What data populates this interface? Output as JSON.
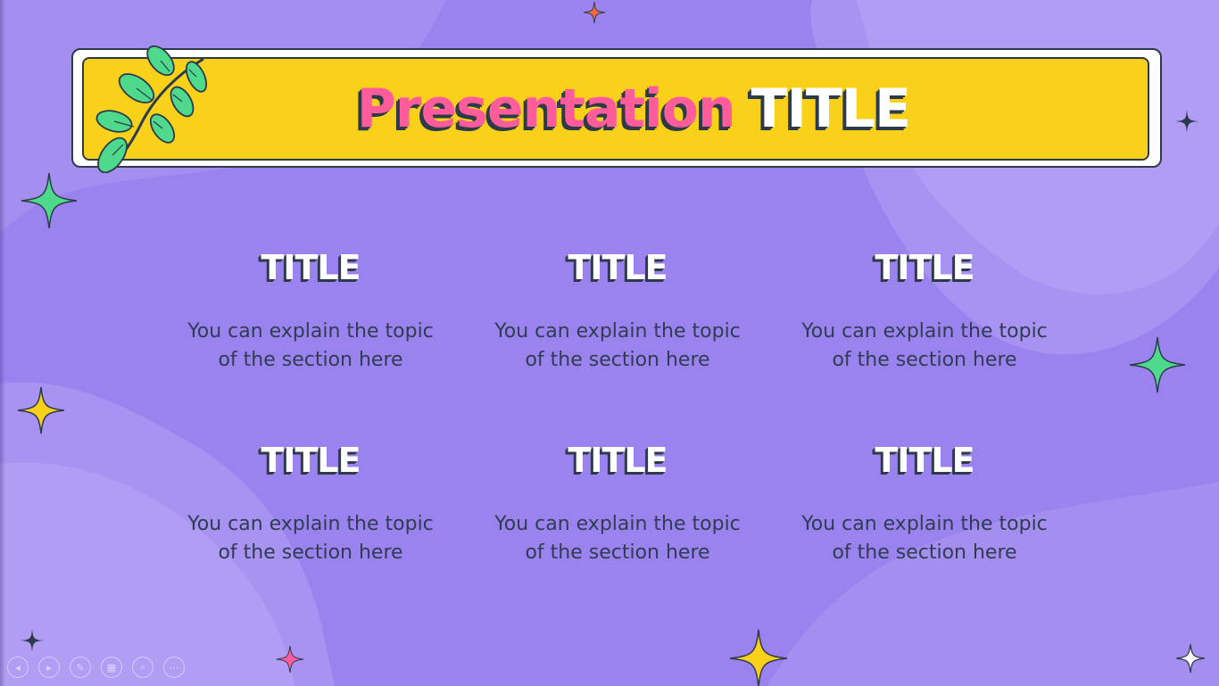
{
  "slide": {
    "title_part1": "Presentation",
    "title_part2": "TITLE",
    "sections": [
      {
        "title": "TITLE",
        "line1": "You can explain the topic",
        "line2": "of the section here"
      },
      {
        "title": "TITLE",
        "line1": "You can explain the topic",
        "line2": "of the section here"
      },
      {
        "title": "TITLE",
        "line1": "You can explain the topic",
        "line2": "of the section here"
      },
      {
        "title": "TITLE",
        "line1": "You can explain the topic",
        "line2": "of the section here"
      },
      {
        "title": "TITLE",
        "line1": "You can explain the topic",
        "line2": "of the section here"
      },
      {
        "title": "TITLE",
        "line1": "You can explain the topic",
        "line2": "of the section here"
      }
    ]
  },
  "colors": {
    "background": "#9b83ef",
    "banner_yellow": "#fad11a",
    "title_pink": "#ff5c9b",
    "outline_dark": "#2c3a4a",
    "sparkle_green": "#4ed98c",
    "sparkle_yellow": "#fad11a",
    "sparkle_pink": "#ff5c9b",
    "sparkle_orange": "#ff6b3d"
  },
  "controls": {
    "prev": "◂",
    "next": "▸",
    "pen": "✎",
    "grid": "▦",
    "zoom": "⌕",
    "more": "⋯"
  },
  "icons": [
    "leaf-branch-icon",
    "sparkle-icon",
    "prev-slide-icon",
    "next-slide-icon",
    "pen-icon",
    "slide-grid-icon",
    "zoom-icon",
    "more-options-icon"
  ]
}
